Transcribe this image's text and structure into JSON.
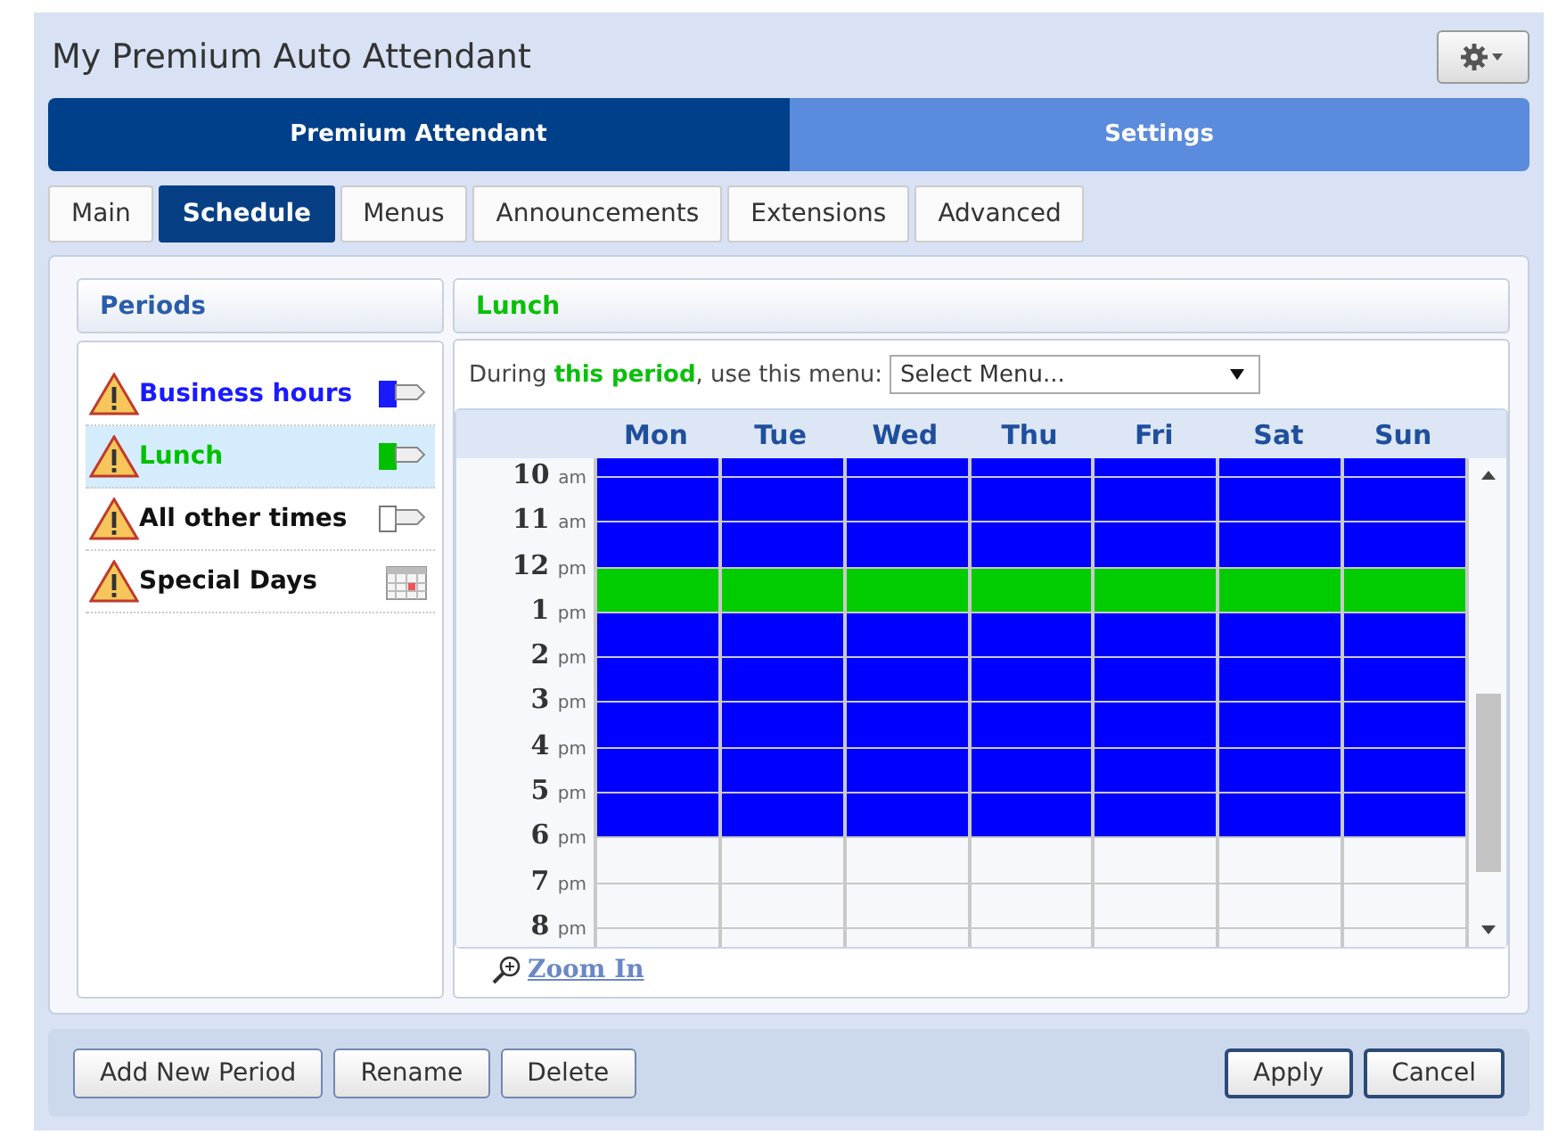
{
  "window": {
    "title": "My Premium Auto Attendant"
  },
  "nav": [
    {
      "label": "Premium Attendant",
      "selected": true
    },
    {
      "label": "Settings",
      "selected": false
    }
  ],
  "tabs": [
    {
      "label": "Main",
      "selected": false
    },
    {
      "label": "Schedule",
      "selected": true
    },
    {
      "label": "Menus",
      "selected": false
    },
    {
      "label": "Announcements",
      "selected": false
    },
    {
      "label": "Extensions",
      "selected": false
    },
    {
      "label": "Advanced",
      "selected": false
    }
  ],
  "periods": {
    "title": "Periods",
    "items": [
      {
        "name": "Business hours",
        "kind": "flag",
        "color": "#1a1aff",
        "selected": false
      },
      {
        "name": "Lunch",
        "kind": "flag",
        "color": "#00c000",
        "selected": true
      },
      {
        "name": "All other times",
        "kind": "flag",
        "selected": false
      },
      {
        "name": "Special Days",
        "kind": "calendar",
        "selected": false
      }
    ]
  },
  "detail": {
    "title": "Lunch",
    "menu_prompt": "During **this period**, use this menu:",
    "menu_select": {
      "value": "Select Menu..."
    },
    "days": [
      "Mon",
      "Tue",
      "Wed",
      "Thu",
      "Fri",
      "Sat",
      "Sun"
    ],
    "slots": [
      {
        "hour": "10",
        "ampm": "am",
        "color": "#0000ff"
      },
      {
        "hour": "11",
        "ampm": "am",
        "color": "#0000ff"
      },
      {
        "hour": "12",
        "ampm": "pm",
        "color": "#00cc00"
      },
      {
        "hour": "1",
        "ampm": "pm",
        "color": "#0000ff"
      },
      {
        "hour": "2",
        "ampm": "pm",
        "color": "#0000ff"
      },
      {
        "hour": "3",
        "ampm": "pm",
        "color": "#0000ff"
      },
      {
        "hour": "4",
        "ampm": "pm",
        "color": "#0000ff"
      },
      {
        "hour": "5",
        "ampm": "pm",
        "color": "#0000ff"
      },
      {
        "hour": "6",
        "ampm": "pm"
      },
      {
        "hour": "7",
        "ampm": "pm"
      },
      {
        "hour": "8",
        "ampm": "pm"
      }
    ],
    "zoom_link": "Zoom In"
  },
  "footer": {
    "left_buttons": [
      "Add New Period",
      "Rename",
      "Delete"
    ],
    "right_buttons": [
      "Apply",
      "Cancel"
    ]
  }
}
